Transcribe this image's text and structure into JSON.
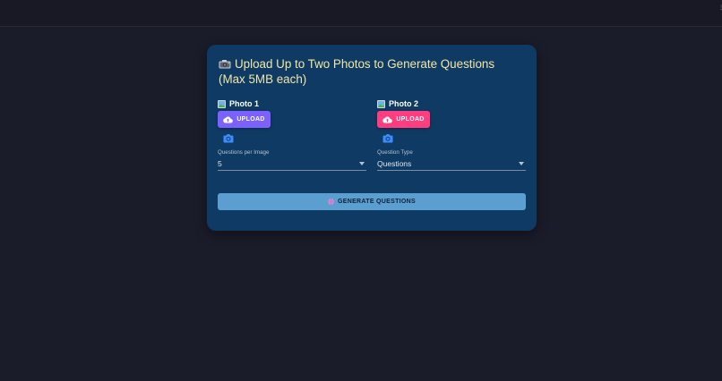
{
  "topbar": {
    "edge_glyph": "⋮"
  },
  "card": {
    "title": "Upload Up to Two Photos to Generate Questions (Max 5MB each)",
    "title_icon": "camera-emoji-icon"
  },
  "photos": [
    {
      "label": "Photo 1",
      "label_icon": "picture-icon",
      "upload_label": "UPLOAD",
      "upload_color": "#7b61ff",
      "camera_icon": "camera-icon"
    },
    {
      "label": "Photo 2",
      "label_icon": "picture-icon",
      "upload_label": "UPLOAD",
      "upload_color": "#ff3d7f",
      "camera_icon": "camera-icon"
    }
  ],
  "settings": {
    "questions_per_image": {
      "label": "Questions per Image",
      "value": "5"
    },
    "question_type": {
      "label": "Question Type",
      "value": "Questions"
    }
  },
  "generate": {
    "label": "GENERATE QUESTIONS",
    "icon": "brain-icon"
  },
  "colors": {
    "background": "#1b1c2a",
    "card": "#0f3a63",
    "title": "#f1e7a8",
    "generate_button": "#5a9fcf",
    "camera_accent": "#3d8bfd"
  }
}
